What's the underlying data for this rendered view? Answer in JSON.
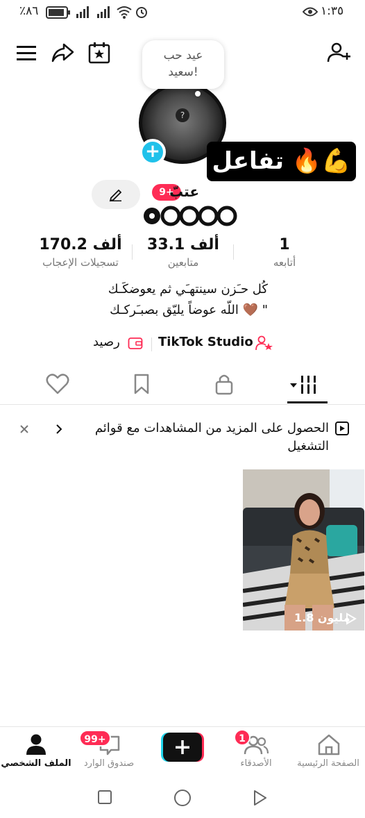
{
  "status_bar": {
    "battery": "٪٨٦",
    "time": "١:٣٥"
  },
  "bubble": {
    "line1": "عيد حب",
    "line2": "سعيد!"
  },
  "avatar": {
    "glyph": "?"
  },
  "interact_banner": {
    "text": "تفاعل 🔥💪"
  },
  "profile": {
    "name": "عتبّ",
    "notification_badge": "9+",
    "stats": [
      {
        "value": "1",
        "label": "أتابعه"
      },
      {
        "value": "33.1 ألف",
        "label": "متابعين"
      },
      {
        "value": "170.2 ألف",
        "label": "تسجيلات الإعجاب"
      }
    ],
    "bio_line1": "كُل حـَزن سينتهـَي ثم يعوضكَـك",
    "bio_line2": "اللّه عوضاً يليّق بصبـَركـك 🤎 \"",
    "studio_label": "TikTok Studio",
    "balance_label": "رصيد"
  },
  "playlist_banner": {
    "text": "الحصول على المزيد من المشاهدات مع قوائم التشغيل"
  },
  "video": {
    "views": "1.8 مليون"
  },
  "bottom_nav": {
    "home": "الصفحة الرئيسية",
    "friends": "الأصدقاء",
    "friends_badge": "1",
    "inbox": "صندوق الوارد",
    "inbox_badge": "99+",
    "profile": "الملف الشخصي"
  },
  "colors": {
    "accent_red": "#fe2c55",
    "accent_cyan": "#20c1ea"
  }
}
